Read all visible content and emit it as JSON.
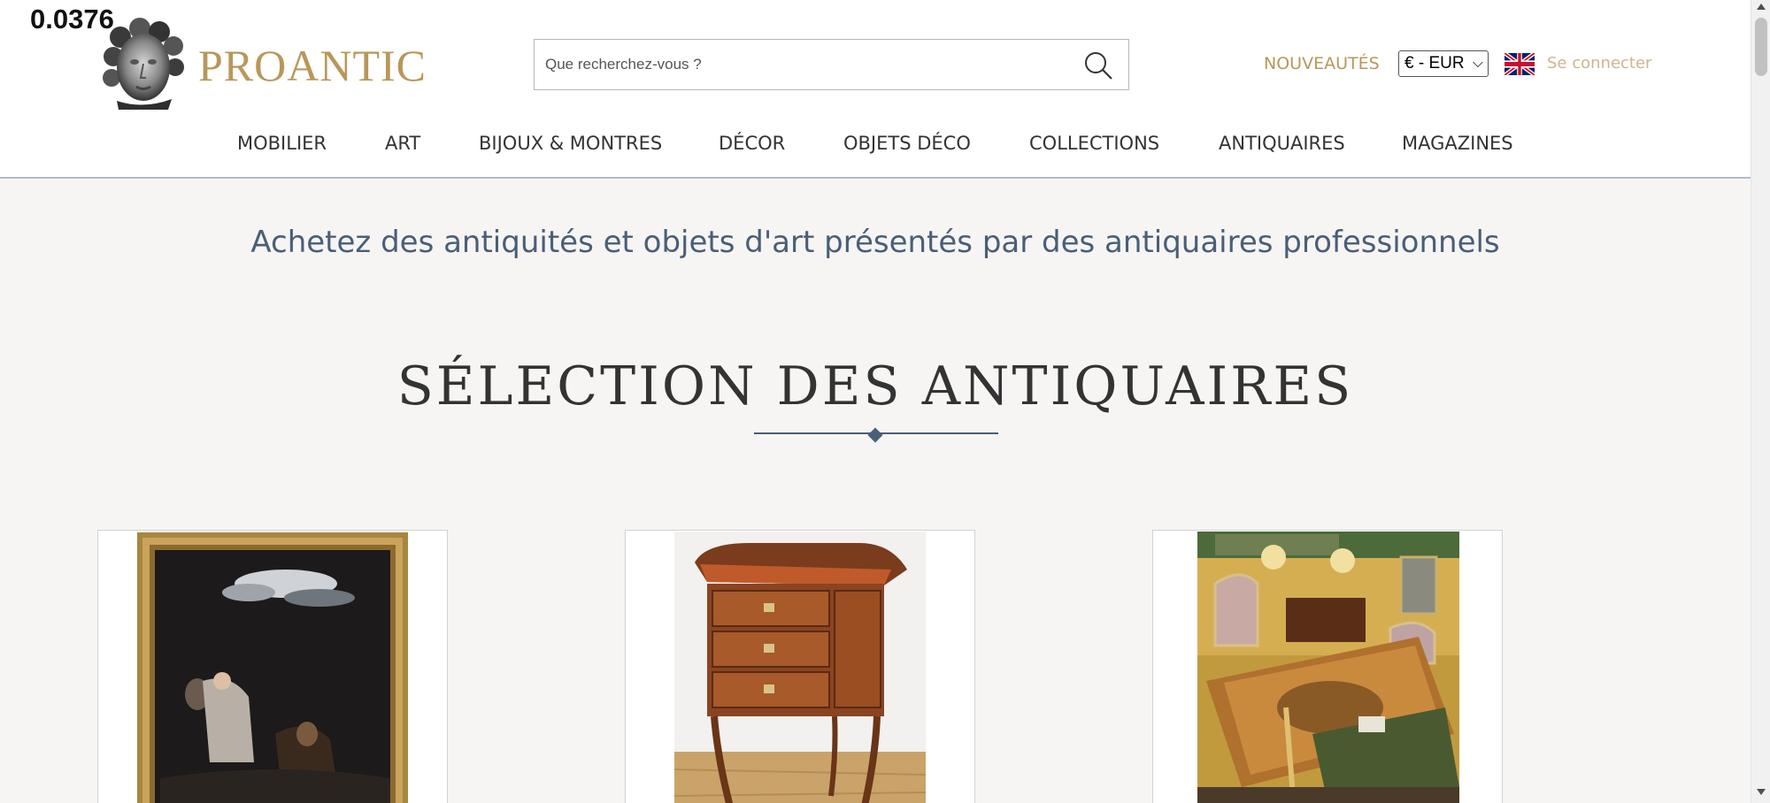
{
  "overlay_value": "0.0376",
  "brand": {
    "name": "PROANTIC",
    "logo_icon": "sculpted-head-icon",
    "color": "#b8975a"
  },
  "search": {
    "placeholder": "Que recherchez-vous ?",
    "icon": "search-icon"
  },
  "header_actions": {
    "new_label": "NOUVEAUTÉS",
    "currency": "€ - EUR",
    "language_icon": "uk-flag-icon",
    "login_label": "Se connecter"
  },
  "nav": [
    {
      "label": "MOBILIER"
    },
    {
      "label": "ART"
    },
    {
      "label": "BIJOUX & MONTRES"
    },
    {
      "label": "DÉCOR"
    },
    {
      "label": "OBJETS DÉCO"
    },
    {
      "label": "COLLECTIONS"
    },
    {
      "label": "ANTIQUAIRES"
    },
    {
      "label": "MAGAZINES"
    }
  ],
  "main": {
    "tagline": "Achetez des antiquités et objets d'art présentés par des antiquaires professionnels",
    "section_title": "SÉLECTION DES ANTIQUAIRES"
  },
  "colors": {
    "accent": "#4a5e78",
    "gold": "#b8975a",
    "background": "#f6f5f3"
  }
}
